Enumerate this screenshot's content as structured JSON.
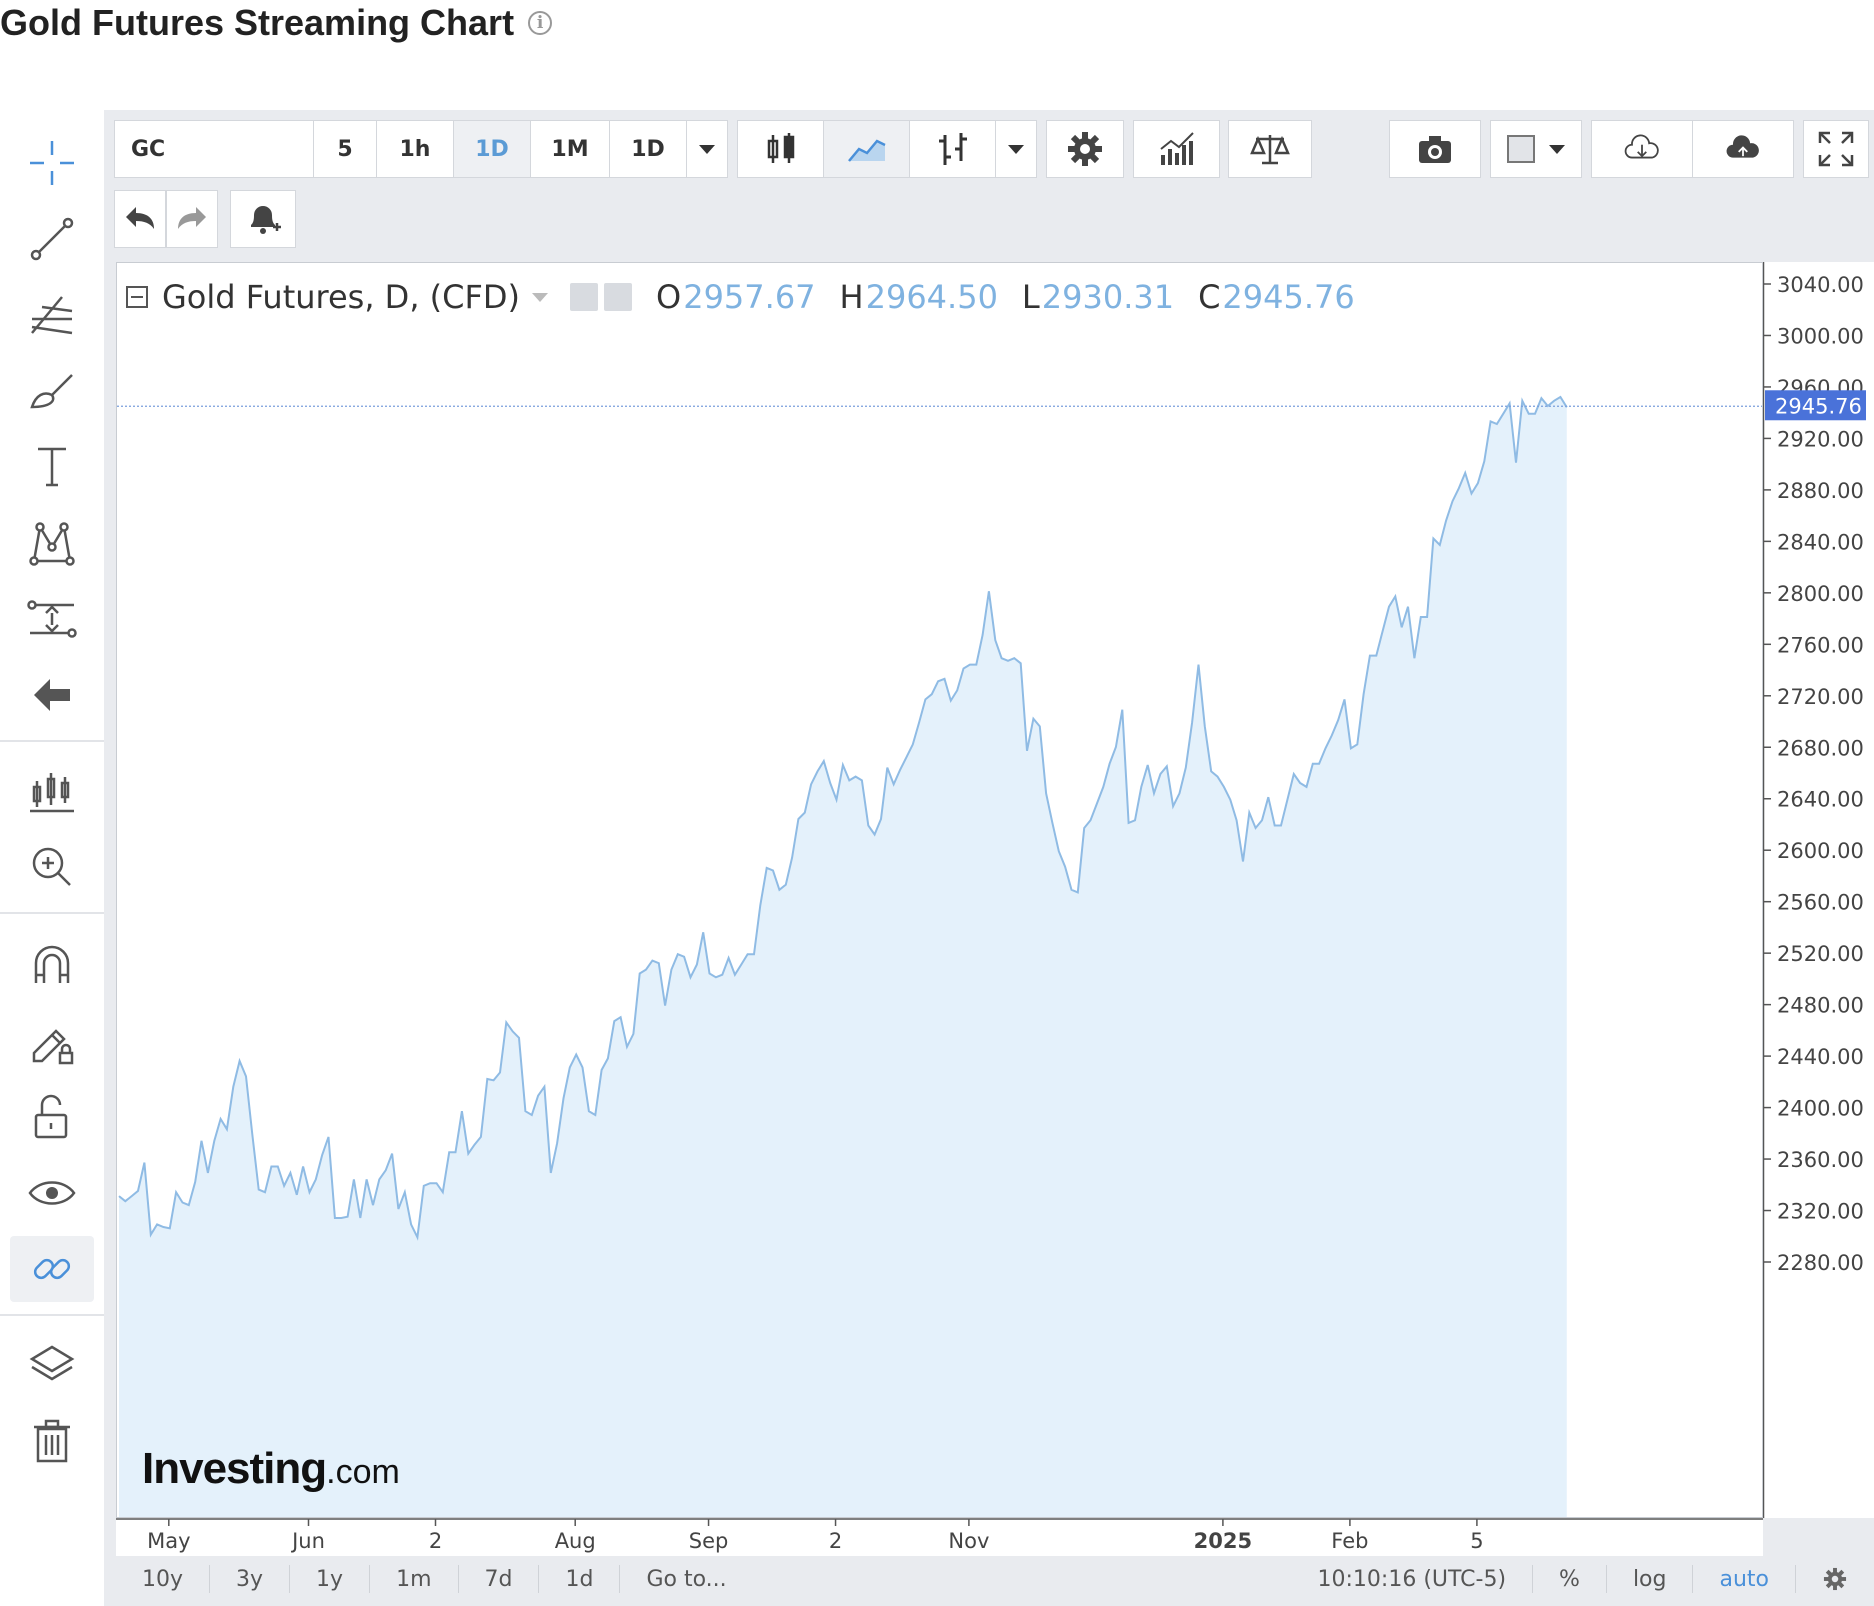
{
  "page": {
    "title": "Gold Futures Streaming Chart"
  },
  "toolbar": {
    "symbol": "GC",
    "intervals": [
      "5",
      "1h",
      "1D",
      "1M",
      "1D"
    ],
    "active_interval_index": 2
  },
  "legend": {
    "title": "Gold Futures, D, (CFD)",
    "open_label": "O",
    "open": "2957.67",
    "high_label": "H",
    "high": "2964.50",
    "low_label": "L",
    "low": "2930.31",
    "close_label": "C",
    "close": "2945.76"
  },
  "price_axis": {
    "ticks": [
      "3040.00",
      "3000.00",
      "2960.00",
      "2920.00",
      "2880.00",
      "2840.00",
      "2800.00",
      "2760.00",
      "2720.00",
      "2680.00",
      "2640.00",
      "2600.00",
      "2560.00",
      "2520.00",
      "2480.00",
      "2440.00",
      "2400.00",
      "2360.00",
      "2320.00",
      "2280.00"
    ],
    "current_price": "2945.76"
  },
  "time_axis": {
    "labels": [
      {
        "text": "May",
        "idx": 8,
        "bold": false
      },
      {
        "text": "Jun",
        "idx": 30,
        "bold": false
      },
      {
        "text": "2",
        "idx": 50,
        "bold": false
      },
      {
        "text": "Aug",
        "idx": 72,
        "bold": false
      },
      {
        "text": "Sep",
        "idx": 93,
        "bold": false
      },
      {
        "text": "2",
        "idx": 113,
        "bold": false
      },
      {
        "text": "Nov",
        "idx": 134,
        "bold": false
      },
      {
        "text": "2025",
        "idx": 174,
        "bold": true
      },
      {
        "text": "Feb",
        "idx": 194,
        "bold": false
      },
      {
        "text": "5",
        "idx": 214,
        "bold": false
      }
    ]
  },
  "bottom_bar": {
    "ranges": [
      "10y",
      "3y",
      "1y",
      "1m",
      "7d",
      "1d",
      "Go to..."
    ],
    "clock": "10:10:16 (UTC-5)",
    "percent": "%",
    "log": "log",
    "auto": "auto"
  },
  "watermark": {
    "text": "Investing",
    "suffix": ".com"
  },
  "colors": {
    "line": "#8fbbe4",
    "area": "#e4f1fb",
    "price_tag": "#4a72d9",
    "accent": "#5b9bd5"
  },
  "icons": {
    "left_toolbar": [
      "crosshair-icon",
      "trend-line-icon",
      "fib-icon",
      "brush-icon",
      "text-icon",
      "pattern-icon",
      "measure-icon",
      "back-arrow-icon",
      "indicators-icon",
      "zoom-in-icon",
      "magnet-icon",
      "lock-drawing-icon",
      "unlock-icon",
      "eye-icon",
      "link-icon",
      "layers-icon",
      "trash-icon"
    ]
  },
  "chart_data": {
    "type": "area",
    "title": "Gold Futures, D, (CFD)",
    "xlabel": "",
    "ylabel": "",
    "ylim": [
      2240,
      3060
    ],
    "x_labels": [
      "May",
      "Jun",
      "2",
      "Aug",
      "Sep",
      "2",
      "Nov",
      "2025",
      "Feb",
      "5"
    ],
    "series": [
      {
        "name": "Gold Futures",
        "values": [
          2332,
          2328,
          2332,
          2336,
          2358,
          2302,
          2310,
          2308,
          2307,
          2335,
          2327,
          2325,
          2343,
          2375,
          2350,
          2375,
          2392,
          2384,
          2417,
          2437,
          2425,
          2380,
          2337,
          2335,
          2355,
          2355,
          2340,
          2350,
          2333,
          2355,
          2335,
          2345,
          2364,
          2378,
          2315,
          2315,
          2316,
          2345,
          2315,
          2345,
          2325,
          2345,
          2352,
          2365,
          2322,
          2335,
          2310,
          2300,
          2340,
          2342,
          2342,
          2335,
          2366,
          2366,
          2398,
          2365,
          2372,
          2378,
          2423,
          2422,
          2428,
          2467,
          2460,
          2455,
          2398,
          2395,
          2410,
          2417,
          2350,
          2373,
          2408,
          2432,
          2442,
          2432,
          2398,
          2395,
          2430,
          2439,
          2468,
          2471,
          2448,
          2458,
          2505,
          2508,
          2515,
          2513,
          2480,
          2508,
          2520,
          2518,
          2502,
          2512,
          2537,
          2505,
          2502,
          2504,
          2517,
          2504,
          2512,
          2520,
          2520,
          2558,
          2587,
          2585,
          2570,
          2574,
          2595,
          2625,
          2630,
          2652,
          2662,
          2670,
          2653,
          2640,
          2667,
          2655,
          2658,
          2655,
          2620,
          2613,
          2625,
          2665,
          2652,
          2663,
          2673,
          2683,
          2700,
          2718,
          2722,
          2732,
          2734,
          2717,
          2725,
          2742,
          2745,
          2745,
          2768,
          2802,
          2764,
          2750,
          2748,
          2750,
          2746,
          2678,
          2703,
          2697,
          2645,
          2622,
          2600,
          2588,
          2570,
          2568,
          2618,
          2624,
          2637,
          2650,
          2668,
          2681,
          2710,
          2622,
          2624,
          2650,
          2667,
          2645,
          2660,
          2666,
          2635,
          2645,
          2665,
          2700,
          2745,
          2697,
          2662,
          2658,
          2650,
          2640,
          2624,
          2592,
          2630,
          2618,
          2624,
          2642,
          2620,
          2620,
          2640,
          2660,
          2653,
          2650,
          2668,
          2668,
          2680,
          2690,
          2702,
          2718,
          2680,
          2683,
          2722,
          2752,
          2752,
          2771,
          2790,
          2798,
          2774,
          2790,
          2750,
          2782,
          2782,
          2843,
          2838,
          2857,
          2872,
          2882,
          2894,
          2878,
          2886,
          2903,
          2934,
          2932,
          2940,
          2948,
          2902,
          2950,
          2940,
          2940,
          2952,
          2946,
          2950,
          2953,
          2945
        ]
      }
    ]
  }
}
